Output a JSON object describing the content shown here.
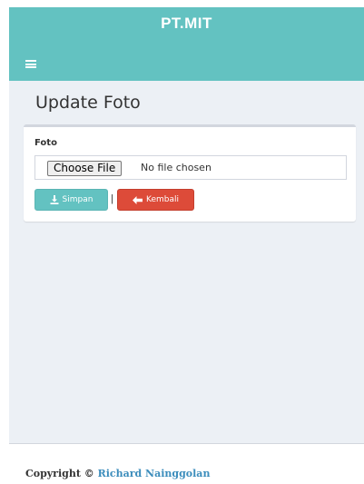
{
  "header": {
    "brand": "PT.MIT",
    "menu_icon": "hamburger-icon"
  },
  "page": {
    "title": "Update Foto"
  },
  "form": {
    "field_label": "Foto",
    "file_button_label": "Choose File",
    "file_status": "No file chosen",
    "separator": "|",
    "save_button": {
      "icon": "download-icon",
      "label": "Simpan"
    },
    "back_button": {
      "icon": "arrow-left-icon",
      "label": "Kembali"
    }
  },
  "footer": {
    "copyright_text": "Copyright ©",
    "author": "Richard Nainggolan"
  },
  "colors": {
    "header_bg": "#63c2c1",
    "save_button": "#63c2c1",
    "back_button": "#dd4b39",
    "link": "#3c8dbc",
    "content_bg": "#ecf0f5"
  }
}
